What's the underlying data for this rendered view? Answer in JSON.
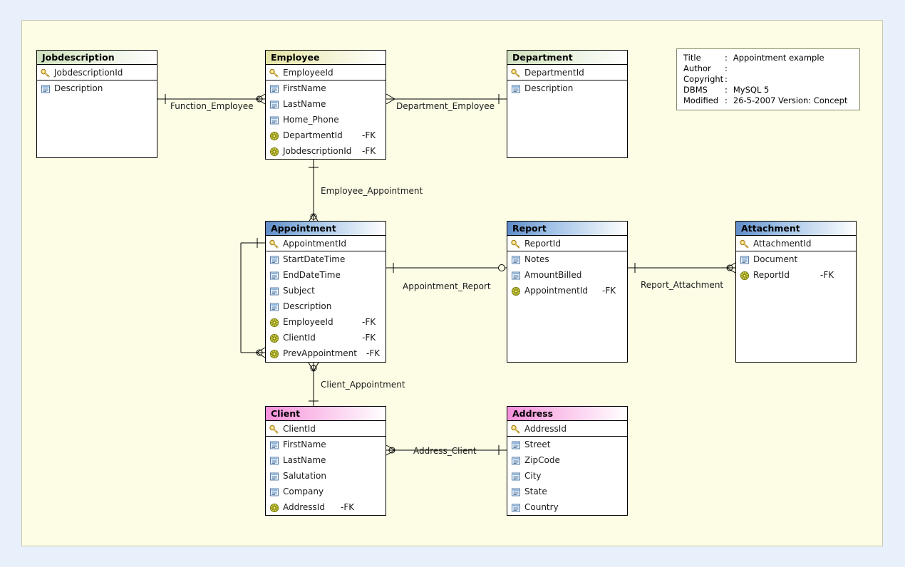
{
  "diagram": {
    "title": "Appointment example",
    "background_color": "#e8f0fb",
    "canvas_color": "#fdfde6"
  },
  "info_box": {
    "rows": [
      {
        "label": "Title",
        "sep": ":",
        "value": "Appointment example"
      },
      {
        "label": "Author",
        "sep": ":",
        "value": ""
      },
      {
        "label": "Copyright",
        "sep": ":",
        "value": ""
      },
      {
        "label": "DBMS",
        "sep": ":",
        "value": "MySQL 5"
      },
      {
        "label": "Modified",
        "sep": ":",
        "value": "26-5-2007 Version: Concept"
      }
    ]
  },
  "entities": [
    {
      "name": "Jobdescription",
      "header_color": "#cfe0c0",
      "rows": [
        {
          "name": "JobdescriptionId",
          "icon": "primary-key-icon",
          "kind": "pk",
          "fk": ""
        },
        {
          "name": "Description",
          "icon": "column-icon",
          "kind": "col",
          "fk": ""
        }
      ]
    },
    {
      "name": "Employee",
      "header_color": "#e4e4a6",
      "rows": [
        {
          "name": "EmployeeId",
          "icon": "primary-key-icon",
          "kind": "pk",
          "fk": ""
        },
        {
          "name": "FirstName",
          "icon": "column-icon",
          "kind": "col",
          "fk": ""
        },
        {
          "name": "LastName",
          "icon": "column-icon",
          "kind": "col",
          "fk": ""
        },
        {
          "name": "Home_Phone",
          "icon": "column-icon",
          "kind": "col",
          "fk": ""
        },
        {
          "name": "DepartmentId",
          "icon": "foreign-key-icon",
          "kind": "fk",
          "fk": "-FK"
        },
        {
          "name": "JobdescriptionId",
          "icon": "foreign-key-icon",
          "kind": "fk",
          "fk": "-FK"
        }
      ]
    },
    {
      "name": "Department",
      "header_color": "#cfe0c0",
      "rows": [
        {
          "name": "DepartmentId",
          "icon": "primary-key-icon",
          "kind": "pk",
          "fk": ""
        },
        {
          "name": "Description",
          "icon": "column-icon",
          "kind": "col",
          "fk": ""
        }
      ]
    },
    {
      "name": "Appointment",
      "header_color": "#5f8cc8",
      "rows": [
        {
          "name": "AppointmentId",
          "icon": "primary-key-icon",
          "kind": "pk",
          "fk": ""
        },
        {
          "name": "StartDateTime",
          "icon": "column-icon",
          "kind": "col",
          "fk": ""
        },
        {
          "name": "EndDateTime",
          "icon": "column-icon",
          "kind": "col",
          "fk": ""
        },
        {
          "name": "Subject",
          "icon": "column-icon",
          "kind": "col",
          "fk": ""
        },
        {
          "name": "Description",
          "icon": "column-icon",
          "kind": "col",
          "fk": ""
        },
        {
          "name": "EmployeeId",
          "icon": "foreign-key-icon",
          "kind": "fk",
          "fk": "-FK"
        },
        {
          "name": "ClientId",
          "icon": "foreign-key-icon",
          "kind": "fk",
          "fk": "-FK"
        },
        {
          "name": "PrevAppointment",
          "icon": "foreign-key-icon",
          "kind": "fk",
          "fk": "-FK"
        }
      ]
    },
    {
      "name": "Report",
      "header_color": "#5f8cc8",
      "rows": [
        {
          "name": "ReportId",
          "icon": "primary-key-icon",
          "kind": "pk",
          "fk": ""
        },
        {
          "name": "Notes",
          "icon": "column-icon",
          "kind": "col",
          "fk": ""
        },
        {
          "name": "AmountBilled",
          "icon": "column-icon",
          "kind": "col",
          "fk": ""
        },
        {
          "name": "AppointmentId",
          "icon": "foreign-key-icon",
          "kind": "fk",
          "fk": "-FK"
        }
      ]
    },
    {
      "name": "Attachment",
      "header_color": "#5f8cc8",
      "rows": [
        {
          "name": "AttachmentId",
          "icon": "primary-key-icon",
          "kind": "pk",
          "fk": ""
        },
        {
          "name": "Document",
          "icon": "column-icon",
          "kind": "col",
          "fk": ""
        },
        {
          "name": "ReportId",
          "icon": "foreign-key-icon",
          "kind": "fk",
          "fk": "-FK"
        }
      ]
    },
    {
      "name": "Client",
      "header_color": "#f58fdc",
      "rows": [
        {
          "name": "ClientId",
          "icon": "primary-key-icon",
          "kind": "pk",
          "fk": ""
        },
        {
          "name": "FirstName",
          "icon": "column-icon",
          "kind": "col",
          "fk": ""
        },
        {
          "name": "LastName",
          "icon": "column-icon",
          "kind": "col",
          "fk": ""
        },
        {
          "name": "Salutation",
          "icon": "column-icon",
          "kind": "col",
          "fk": ""
        },
        {
          "name": "Company",
          "icon": "column-icon",
          "kind": "col",
          "fk": ""
        },
        {
          "name": "AddressId",
          "icon": "foreign-key-icon",
          "kind": "fk",
          "fk": "-FK"
        }
      ]
    },
    {
      "name": "Address",
      "header_color": "#f58fdc",
      "rows": [
        {
          "name": "AddressId",
          "icon": "primary-key-icon",
          "kind": "pk",
          "fk": ""
        },
        {
          "name": "Street",
          "icon": "column-icon",
          "kind": "col",
          "fk": ""
        },
        {
          "name": "ZipCode",
          "icon": "column-icon",
          "kind": "col",
          "fk": ""
        },
        {
          "name": "City",
          "icon": "column-icon",
          "kind": "col",
          "fk": ""
        },
        {
          "name": "State",
          "icon": "column-icon",
          "kind": "col",
          "fk": ""
        },
        {
          "name": "Country",
          "icon": "column-icon",
          "kind": "col",
          "fk": ""
        }
      ]
    }
  ],
  "relationships": [
    {
      "label": "Function_Employee",
      "from": "Jobdescription",
      "to": "Employee"
    },
    {
      "label": "Department_Employee",
      "from": "Employee",
      "to": "Department"
    },
    {
      "label": "Employee_Appointment",
      "from": "Employee",
      "to": "Appointment"
    },
    {
      "label": "Appointment_Report",
      "from": "Appointment",
      "to": "Report"
    },
    {
      "label": "Report_Attachment",
      "from": "Report",
      "to": "Attachment"
    },
    {
      "label": "Client_Appointment",
      "from": "Client",
      "to": "Appointment"
    },
    {
      "label": "Address_Client",
      "from": "Address",
      "to": "Client"
    }
  ]
}
